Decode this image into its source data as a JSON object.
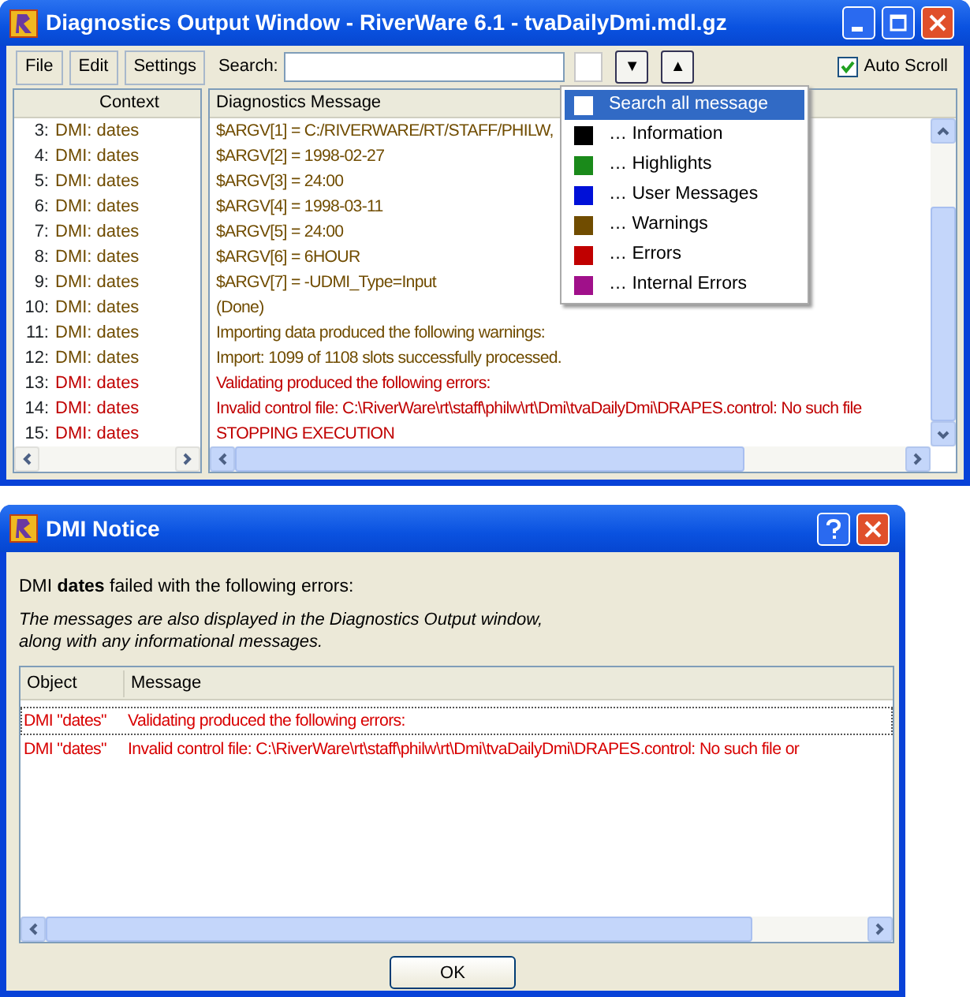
{
  "diagnostics_window": {
    "title": "Diagnostics Output Window - RiverWare 6.1 - tvaDailyDmi.mdl.gz",
    "menu_buttons": [
      "File",
      "Edit",
      "Settings"
    ],
    "search": {
      "label": "Search:",
      "down": "▼",
      "up": "▲"
    },
    "auto_scroll": {
      "label": "Auto Scroll",
      "checked": true
    },
    "columns": [
      "Context",
      "Diagnostics Message"
    ],
    "rows": [
      {
        "index": "3:",
        "context": "DMI: dates",
        "message": "$ARGV[1] = C:/RIVERWARE/RT/STAFF/PHILW,",
        "kind": "warning"
      },
      {
        "index": "4:",
        "context": "DMI: dates",
        "message": "$ARGV[2] = 1998-02-27",
        "kind": "warning"
      },
      {
        "index": "5:",
        "context": "DMI: dates",
        "message": "$ARGV[3] = 24:00",
        "kind": "warning"
      },
      {
        "index": "6:",
        "context": "DMI: dates",
        "message": "$ARGV[4] = 1998-03-11",
        "kind": "warning"
      },
      {
        "index": "7:",
        "context": "DMI: dates",
        "message": "$ARGV[5] = 24:00",
        "kind": "warning"
      },
      {
        "index": "8:",
        "context": "DMI: dates",
        "message": "$ARGV[6] = 6HOUR",
        "kind": "warning"
      },
      {
        "index": "9:",
        "context": "DMI: dates",
        "message": "$ARGV[7] = -UDMI_Type=Input",
        "kind": "warning"
      },
      {
        "index": "10:",
        "context": "DMI: dates",
        "message": "(Done)",
        "kind": "warning"
      },
      {
        "index": "11:",
        "context": "DMI: dates",
        "message": "Importing data produced the following warnings:",
        "kind": "warning"
      },
      {
        "index": "12:",
        "context": "DMI: dates",
        "message": "Import: 1099 of 1108 slots successfully processed.",
        "kind": "warning"
      },
      {
        "index": "13:",
        "context": "DMI: dates",
        "message": "Validating produced the following errors:",
        "kind": "error"
      },
      {
        "index": "14:",
        "context": "DMI: dates",
        "message": "Invalid control file: C:\\RiverWare\\rt\\staff\\philw\\rt\\Dmi\\tvaDailyDmi\\DRAPES.control: No such file",
        "kind": "error"
      },
      {
        "index": "15:",
        "context": "DMI: dates",
        "message": "STOPPING EXECUTION",
        "kind": "error"
      }
    ],
    "filter_menu": [
      {
        "label": "Search all message",
        "color": "#ffffff",
        "selected": true
      },
      {
        "label": "… Information",
        "color": "#000000",
        "selected": false
      },
      {
        "label": "… Highlights",
        "color": "#1a8a1a",
        "selected": false
      },
      {
        "label": "… User Messages",
        "color": "#0010d8",
        "selected": false
      },
      {
        "label": "… Warnings",
        "color": "#704c00",
        "selected": false
      },
      {
        "label": "… Errors",
        "color": "#c00000",
        "selected": false
      },
      {
        "label": "… Internal Errors",
        "color": "#a0108a",
        "selected": false
      }
    ]
  },
  "dmi_notice": {
    "title": "DMI Notice",
    "intro": "DMI **dates** failed with the following errors:",
    "note": "The messages are also displayed in the Diagnostics Output window,\nalong with any informational messages.",
    "columns": [
      "Object",
      "Message"
    ],
    "rows": [
      {
        "object": "DMI \"dates\"",
        "message": "Validating produced the following errors:",
        "focused": true
      },
      {
        "object": "DMI \"dates\"",
        "message": "Invalid control file: C:\\RiverWare\\rt\\staff\\philw\\rt\\Dmi\\tvaDailyDmi\\DRAPES.control: No such file or",
        "focused": false
      }
    ],
    "ok": "OK"
  }
}
